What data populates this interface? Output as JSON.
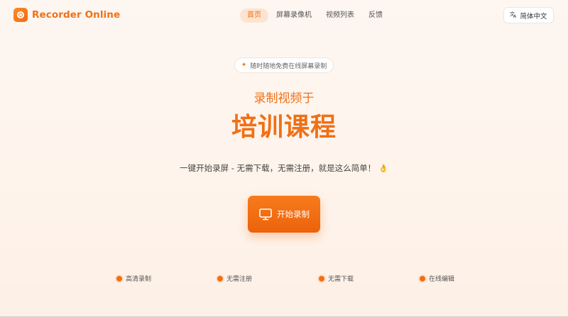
{
  "brand": {
    "name": "Recorder Online",
    "accent": "#f07016"
  },
  "nav": {
    "items": [
      {
        "label": "首页",
        "active": true
      },
      {
        "label": "屏幕录像机",
        "active": false
      },
      {
        "label": "视频列表",
        "active": false
      },
      {
        "label": "反馈",
        "active": false
      }
    ]
  },
  "language": {
    "label": "简体中文",
    "icon": "translate-icon"
  },
  "hero": {
    "badge": {
      "icon": "sparkle-icon",
      "text": "随时随地免费在线屏幕录制"
    },
    "subtitle": "录制视频于",
    "title": "培训课程",
    "tagline": "一键开始录屏 - 无需下载，无需注册，就是这么简单！",
    "tagline_emoji": "👌",
    "cta": {
      "label": "开始录制",
      "icon": "monitor-icon"
    }
  },
  "features": [
    {
      "label": "高清录制"
    },
    {
      "label": "无需注册"
    },
    {
      "label": "无需下载"
    },
    {
      "label": "在线编辑"
    }
  ]
}
